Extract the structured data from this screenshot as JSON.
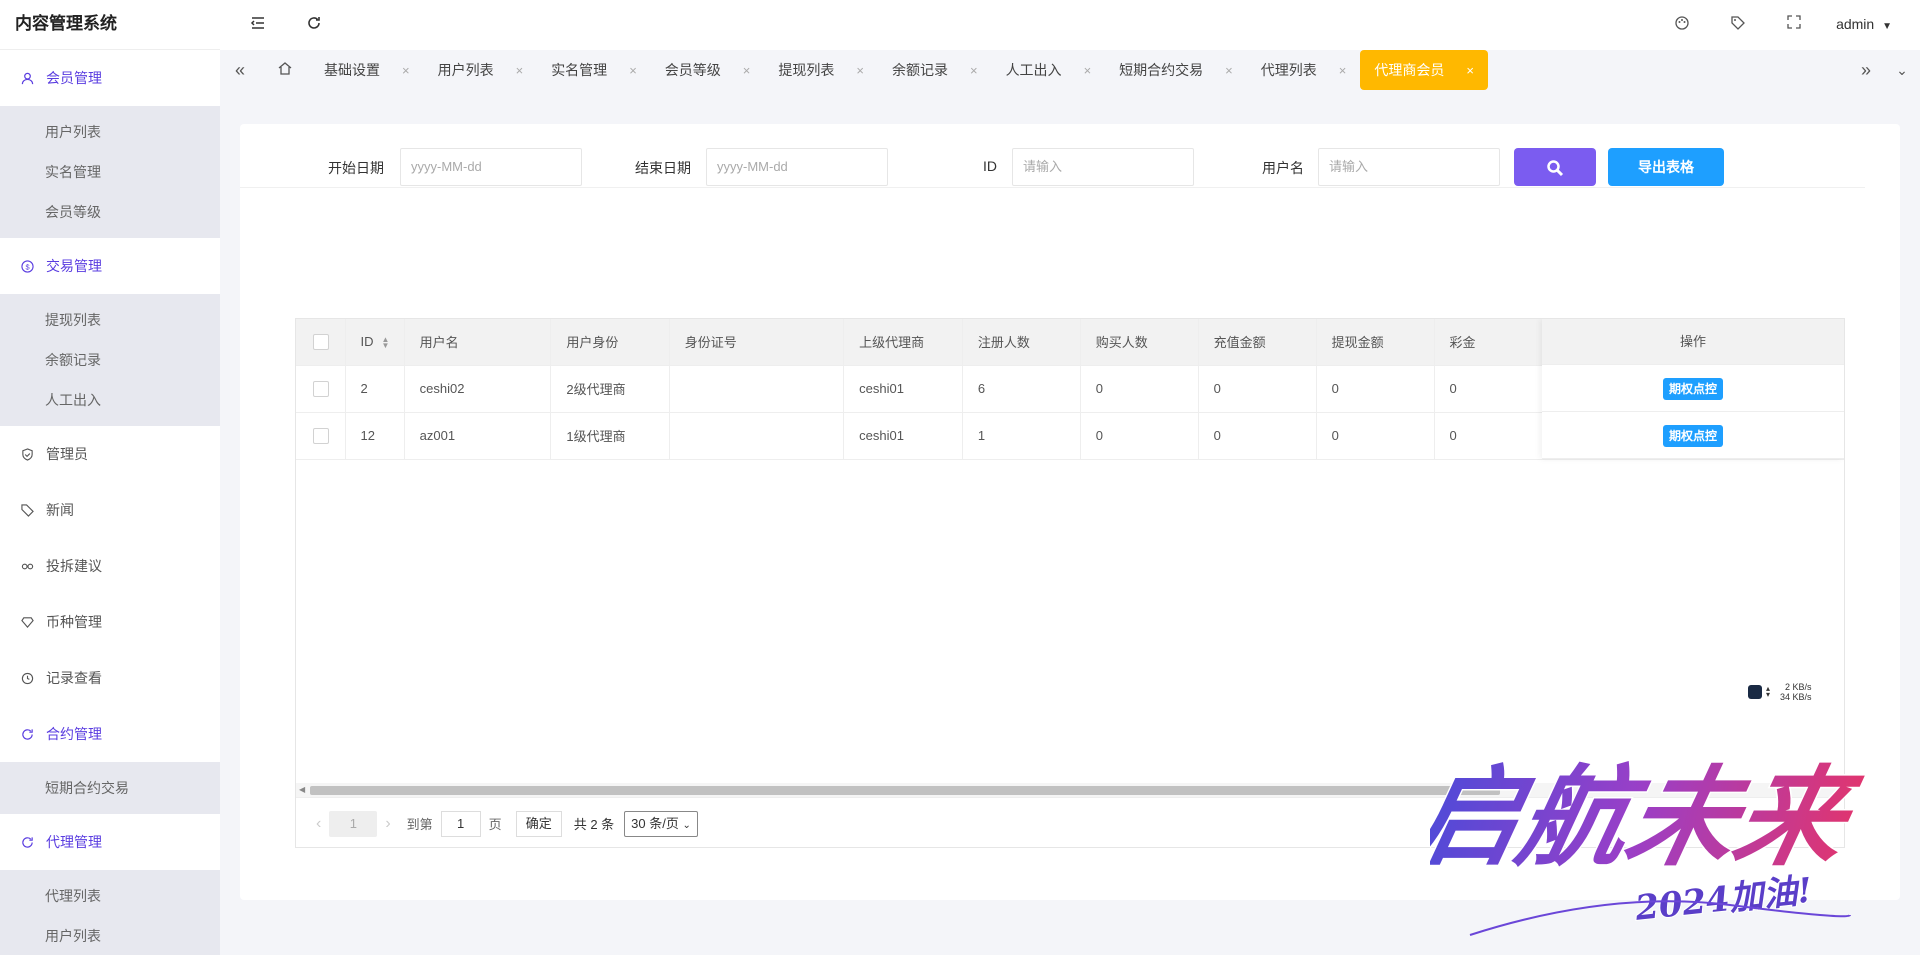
{
  "app": {
    "title": "内容管理系统"
  },
  "header": {
    "user": "admin"
  },
  "sidebar": {
    "groups": [
      {
        "label": "会员管理",
        "icon": "user-icon",
        "active": true,
        "items": [
          "用户列表",
          "实名管理",
          "会员等级"
        ]
      },
      {
        "label": "交易管理",
        "icon": "dollar-icon",
        "active": true,
        "items": [
          "提现列表",
          "余额记录",
          "人工出入"
        ]
      },
      {
        "label": "管理员",
        "icon": "shield-icon",
        "active": false,
        "items": []
      },
      {
        "label": "新闻",
        "icon": "tag-icon",
        "active": false,
        "items": []
      },
      {
        "label": "投拆建议",
        "icon": "link-icon",
        "active": false,
        "items": []
      },
      {
        "label": "币种管理",
        "icon": "diamond-icon",
        "active": false,
        "items": []
      },
      {
        "label": "记录查看",
        "icon": "clock-icon",
        "active": false,
        "items": []
      },
      {
        "label": "合约管理",
        "icon": "refresh-icon",
        "active": true,
        "items": [
          "短期合约交易"
        ]
      },
      {
        "label": "代理管理",
        "icon": "refresh-icon",
        "active": true,
        "items": [
          "代理列表",
          "用户列表"
        ]
      }
    ]
  },
  "tabs": [
    {
      "label": "基础设置",
      "active": false
    },
    {
      "label": "用户列表",
      "active": false
    },
    {
      "label": "实名管理",
      "active": false
    },
    {
      "label": "会员等级",
      "active": false
    },
    {
      "label": "提现列表",
      "active": false
    },
    {
      "label": "余额记录",
      "active": false
    },
    {
      "label": "人工出入",
      "active": false
    },
    {
      "label": "短期合约交易",
      "active": false
    },
    {
      "label": "代理列表",
      "active": false
    },
    {
      "label": "代理商会员",
      "active": true
    }
  ],
  "tab_close": "×",
  "filter": {
    "start_label": "开始日期",
    "start_placeholder": "yyyy-MM-dd",
    "end_label": "结束日期",
    "end_placeholder": "yyyy-MM-dd",
    "id_label": "ID",
    "id_placeholder": "请输入",
    "username_label": "用户名",
    "username_placeholder": "请输入",
    "export_label": "导出表格"
  },
  "table": {
    "columns": [
      "ID",
      "用户名",
      "用户身份",
      "身份证号",
      "上级代理商",
      "注册人数",
      "购买人数",
      "充值金额",
      "提现金额",
      "彩金"
    ],
    "ops_header": "操作",
    "rows": [
      {
        "id": "2",
        "username": "ceshi02",
        "identity": "2级代理商",
        "idcard": "",
        "parent": "ceshi01",
        "registered": "6",
        "buyers": "0",
        "recharge": "0",
        "withdraw": "0",
        "bonus": "0",
        "op": "期权点控"
      },
      {
        "id": "12",
        "username": "az001",
        "identity": "1级代理商",
        "idcard": "",
        "parent": "ceshi01",
        "registered": "1",
        "buyers": "0",
        "recharge": "0",
        "withdraw": "0",
        "bonus": "0",
        "op": "期权点控"
      }
    ]
  },
  "pager": {
    "current": "1",
    "goto_label": "到第",
    "goto_value": "1",
    "page_unit": "页",
    "confirm": "确定",
    "total": "共 2 条",
    "page_size": "30 条/页"
  },
  "netspeed": {
    "up": "2 KB/s",
    "down": "34 KB/s"
  },
  "banner": {
    "main": "启航未来",
    "sub": "2024加油!"
  },
  "colors": {
    "accent": "#5a3de0",
    "active_tab": "#ffb800",
    "search_btn": "#7b5cf0",
    "primary_btn": "#1e9fff"
  }
}
